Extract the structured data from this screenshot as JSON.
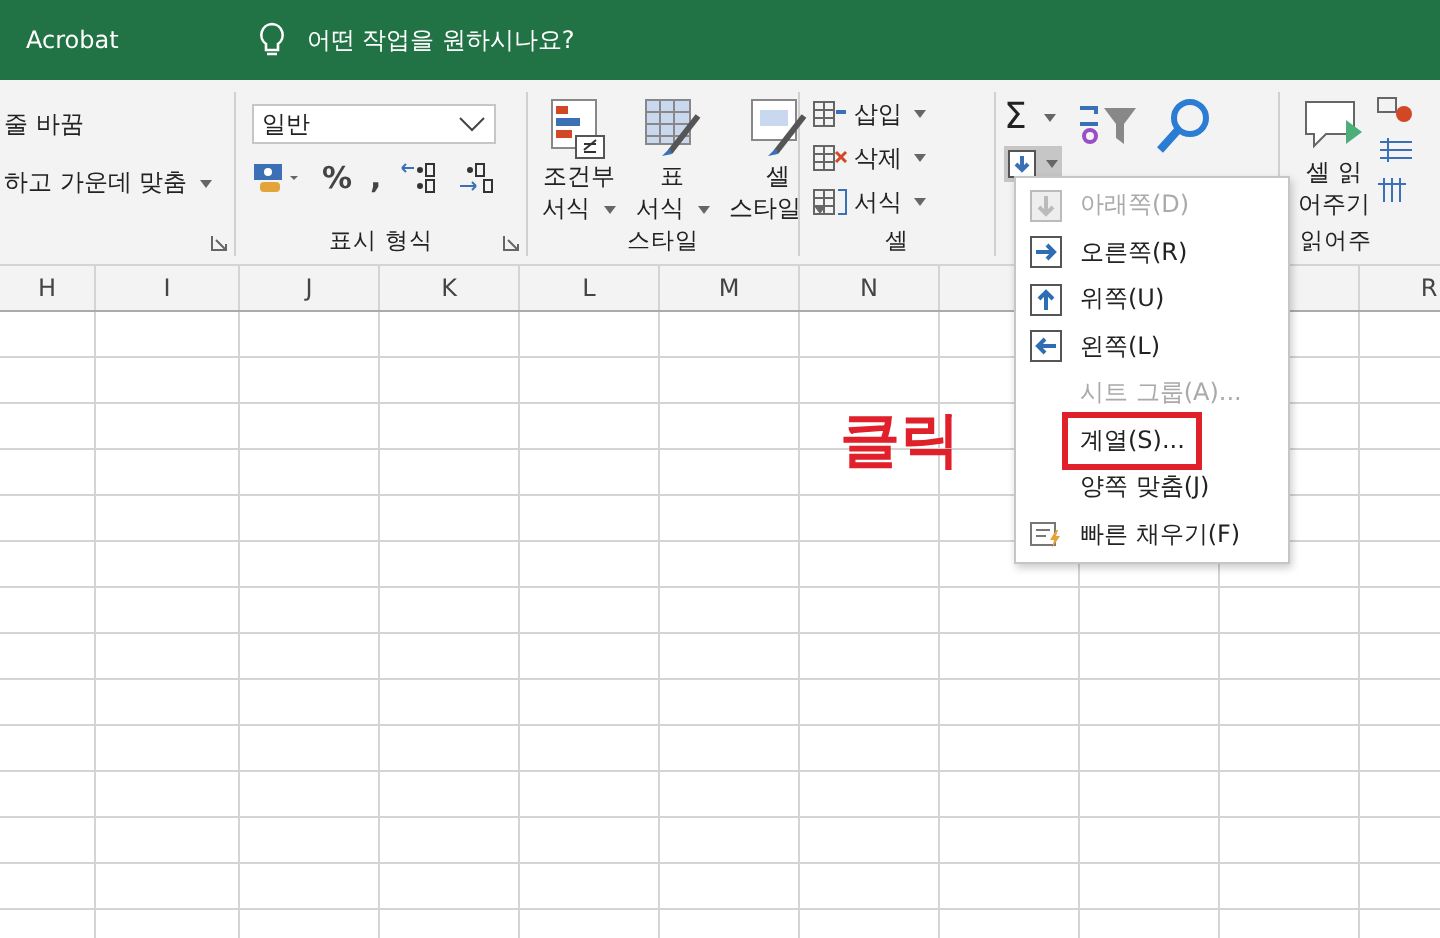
{
  "title_bar": {
    "app_label": "Acrobat",
    "search_placeholder": "어떤 작업을 원하시나요?"
  },
  "ribbon": {
    "alignment": {
      "wrap_label": "줄 바꿈",
      "merge_label": "하고 가운데 맞춤"
    },
    "number": {
      "format_value": "일반",
      "percent": "%",
      "comma": ",",
      "group_label": "표시 형식"
    },
    "styles": {
      "buttons": [
        {
          "kind": "conditional",
          "line1": "조건부",
          "line2": "서식"
        },
        {
          "kind": "table",
          "line1": "표",
          "line2": "서식"
        },
        {
          "kind": "cell",
          "line1": "셀",
          "line2": "스타일"
        }
      ],
      "group_label": "스타일"
    },
    "cells": {
      "buttons": [
        {
          "kind": "insert",
          "label": "삽입"
        },
        {
          "kind": "delete",
          "label": "삭제"
        },
        {
          "kind": "format",
          "label": "서식"
        }
      ],
      "group_label": "셀"
    },
    "editing": {
      "sum_symbol": "Σ",
      "fill_pressed": true
    },
    "read": {
      "line1": "셀 읽",
      "line2": "어주기",
      "group_label": "읽어주"
    }
  },
  "columns_left": [
    "H",
    "I",
    "J",
    "K",
    "L",
    "M",
    "N"
  ],
  "columns_right": [
    "R"
  ],
  "fill_menu": {
    "items": [
      {
        "kind": "down",
        "label": "아래쪽(D)",
        "disabled": true,
        "marked": false
      },
      {
        "kind": "right",
        "label": "오른쪽(R)",
        "disabled": false,
        "marked": false
      },
      {
        "kind": "up",
        "label": "위쪽(U)",
        "disabled": false,
        "marked": false
      },
      {
        "kind": "left",
        "label": "왼쪽(L)",
        "disabled": false,
        "marked": false
      },
      {
        "kind": "plain",
        "label": "시트 그룹(A)...",
        "disabled": true,
        "marked": false
      },
      {
        "kind": "plain",
        "label": "계열(S)...",
        "disabled": false,
        "marked": true
      },
      {
        "kind": "plain",
        "label": "양쪽 맞춤(J)",
        "disabled": false,
        "marked": false
      },
      {
        "kind": "flash",
        "label": "빠른 채우기(F)",
        "disabled": false,
        "marked": false
      }
    ]
  },
  "annotation": "클릭"
}
